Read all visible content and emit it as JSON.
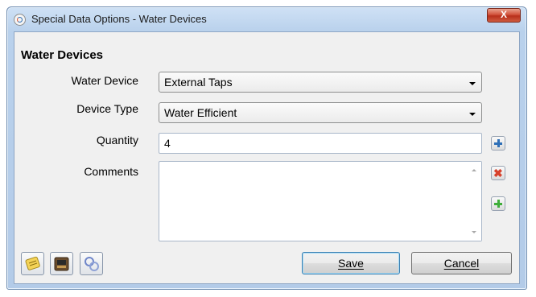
{
  "window": {
    "title": "Special Data Options - Water Devices",
    "close_label": "X"
  },
  "group": {
    "title": "Water Devices"
  },
  "form": {
    "water_device": {
      "label": "Water Device",
      "value": "External Taps"
    },
    "device_type": {
      "label": "Device Type",
      "value": "Water Efficient"
    },
    "quantity": {
      "label": "Quantity",
      "value": "4"
    },
    "comments": {
      "label": "Comments",
      "value": ""
    }
  },
  "side_icons": [
    "add-icon",
    "delete-icon",
    "add-green-icon"
  ],
  "bottom_icons": [
    "notes-icon",
    "archive-icon",
    "help-icon"
  ],
  "buttons": {
    "save": {
      "label": "Save",
      "underline": "S"
    },
    "cancel": {
      "label": "Cancel",
      "underline": "C"
    }
  },
  "colors": {
    "accent_blue": "#2e6fb7",
    "delete_red": "#d7402b",
    "add_green": "#3fae3a",
    "close_red": "#c9432b"
  }
}
